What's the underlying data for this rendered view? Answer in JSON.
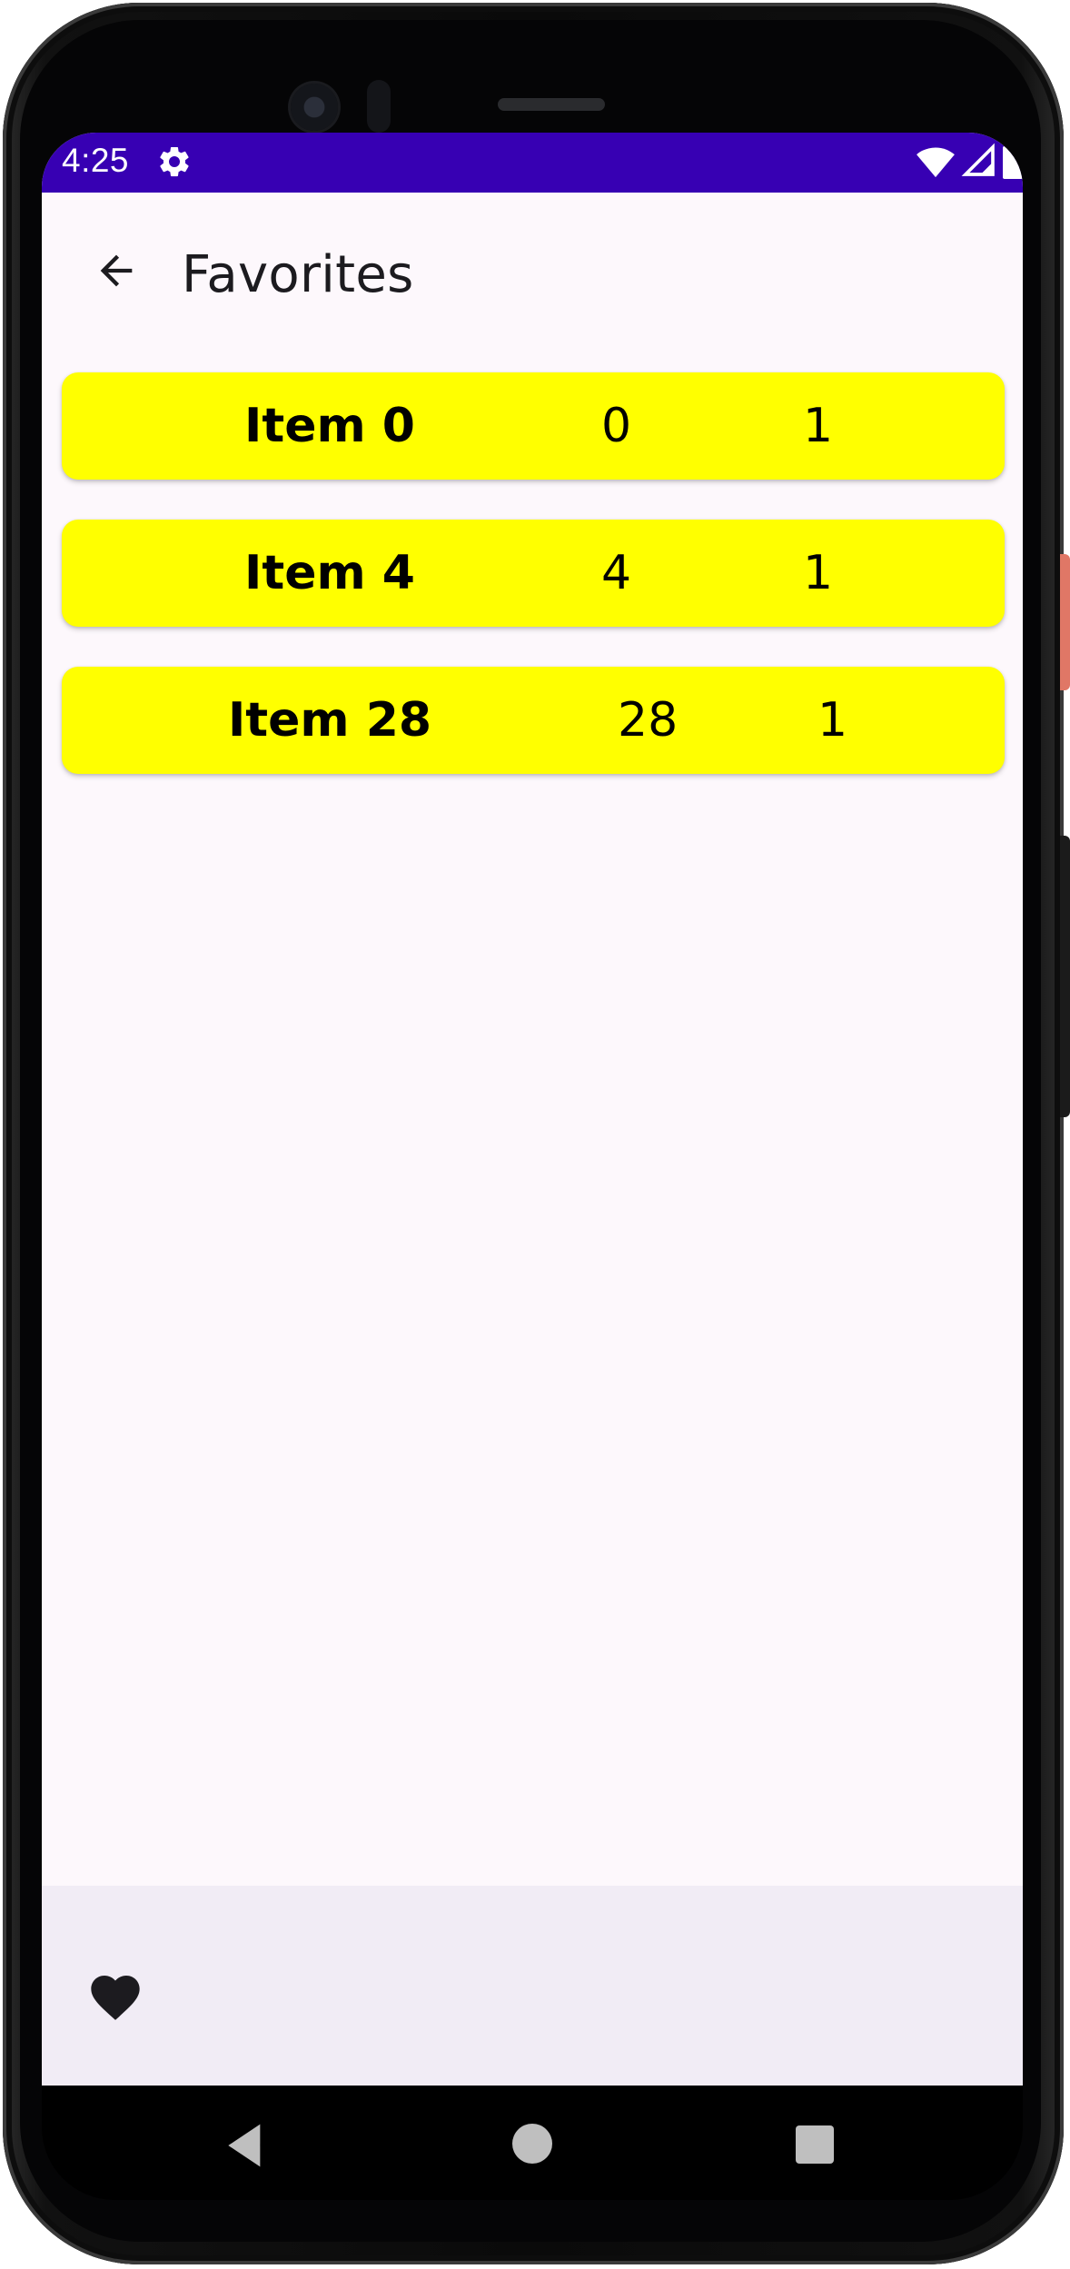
{
  "status_bar": {
    "time": "4:25",
    "icons": [
      "settings-icon",
      "wifi-icon",
      "signal-icon",
      "battery-icon"
    ],
    "background_color": "#3700b3"
  },
  "app_bar": {
    "title": "Favorites",
    "back_icon": "arrow-back-icon"
  },
  "favorites": [
    {
      "name": "Item 0",
      "value": "0",
      "count": "1"
    },
    {
      "name": "Item 4",
      "value": "4",
      "count": "1"
    },
    {
      "name": "Item 28",
      "value": "28",
      "count": "1"
    }
  ],
  "bottom_bar": {
    "icon": "heart-icon",
    "background_color": "#f1ecf5"
  },
  "colors": {
    "card_background": "#ffff00",
    "screen_background": "#fdf8fc"
  },
  "nav_bar": {
    "icons": [
      "back-triangle-icon",
      "home-circle-icon",
      "recents-square-icon"
    ]
  }
}
